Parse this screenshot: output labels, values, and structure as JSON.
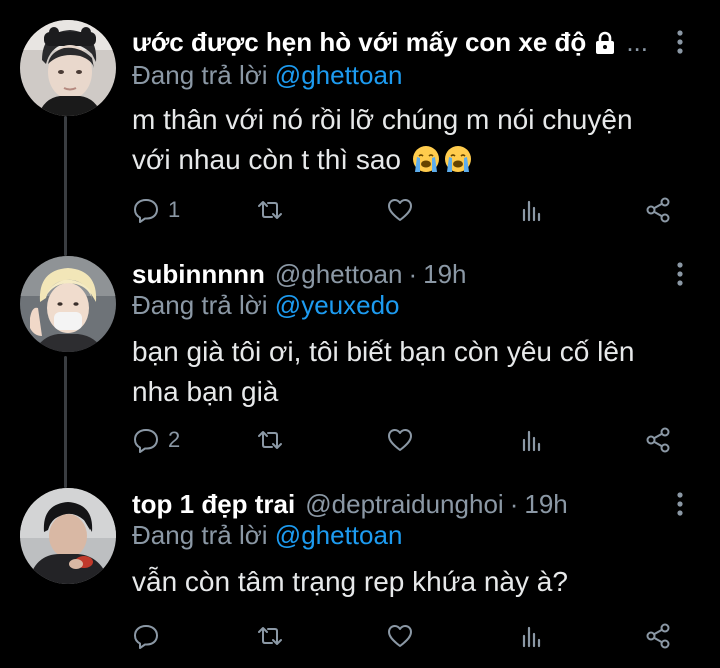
{
  "tweets": [
    {
      "name": "ước được hẹn hò với mấy con xe độ",
      "truncated": "...",
      "handle": "",
      "separator": "",
      "time": "",
      "locked": true,
      "reply_prefix": "Đang trả lời",
      "reply_handle": "@ghettoan",
      "text": "m thân với nó rồi lỡ chúng m nói chuyện với nhau còn t thì sao",
      "reply_count": "1",
      "retweet_count": "",
      "like_count": "",
      "view_count": ""
    },
    {
      "name": "subinnnnn",
      "truncated": "",
      "handle": "@ghettoan",
      "separator": "·",
      "time": "19h",
      "locked": false,
      "reply_prefix": "Đang trả lời",
      "reply_handle": "@yeuxedo",
      "text": "bạn già tôi ơi, tôi biết bạn còn yêu cố lên nha bạn già",
      "reply_count": "2",
      "retweet_count": "",
      "like_count": "",
      "view_count": ""
    },
    {
      "name": "top 1 đẹp trai",
      "truncated": "",
      "handle": "@deptraidunghoi",
      "separator": "·",
      "time": "19h",
      "locked": false,
      "reply_prefix": "Đang trả lời",
      "reply_handle": "@ghettoan",
      "text": "vẫn còn tâm trạng rep khứa này à?",
      "reply_count": "",
      "retweet_count": "",
      "like_count": "",
      "view_count": ""
    }
  ],
  "icons": {
    "reply": "reply-icon",
    "retweet": "retweet-icon",
    "like": "heart-icon",
    "views": "views-icon",
    "share": "share-icon",
    "more": "more-vertical-icon",
    "lock": "lock-icon",
    "emoji": "loudly-crying-face-emoji"
  },
  "colors": {
    "background": "#000000",
    "text": "#e7e9ea",
    "secondary": "#8b98a5",
    "mention": "#1d9bf0",
    "thread_line": "#3a3d41"
  }
}
